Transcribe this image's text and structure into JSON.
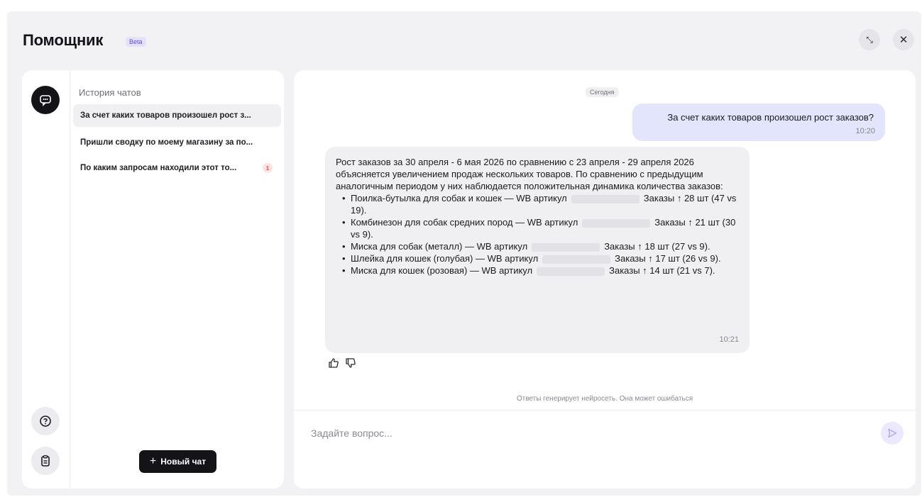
{
  "header": {
    "title": "Помощник",
    "beta": "Beta"
  },
  "sidebar": {
    "history_title": "История чатов",
    "chats": [
      {
        "label": "За счет каких товаров произошел рост з..."
      },
      {
        "label": "Пришли сводку по моему магазину за по..."
      },
      {
        "label": "По каким запросам находили этот то...",
        "badge": "1"
      }
    ],
    "new_chat_label": "Новый чат"
  },
  "conversation": {
    "date_label": "Сегодня",
    "user_message": {
      "text": "За счет каких товаров произошел рост заказов?",
      "time": "10:20"
    },
    "assistant_message": {
      "intro": "Рост заказов за 30 апреля - 6 мая 2026 по сравнению с 23 апреля - 29 апреля 2026 объясняется увеличением продаж нескольких товаров. По сравнению с предыдущим аналогичным периодом у них наблюдается положительная динамика количества заказов:",
      "items": [
        {
          "before": "Поилка-бутылка для собак и кошек  — WB артикул",
          "after": "Заказы ↑ 28 шт (47 vs 19)."
        },
        {
          "before": "Комбинезон для собак средних пород — WB артикул",
          "after": "Заказы ↑ 21 шт (30 vs 9)."
        },
        {
          "before": "Миска для собак (металл) — WB артикул",
          "after": "Заказы ↑ 18 шт (27 vs 9)."
        },
        {
          "before": "Шлейка для кошек (голубая) — WB артикул",
          "after": "Заказы ↑ 17 шт (26 vs 9)."
        },
        {
          "before": "Миска для кошек (розовая) — WB артикул",
          "after": "Заказы ↑ 14 шт (21 vs 7)."
        }
      ],
      "time": "10:21"
    },
    "disclaimer": "Ответы генерирует нейросеть. Она может ошибаться"
  },
  "input": {
    "placeholder": "Задайте вопрос..."
  },
  "colors": {
    "accent": "#b3a6f4",
    "user_bubble": "#e2e5fb",
    "dark": "#141418"
  }
}
